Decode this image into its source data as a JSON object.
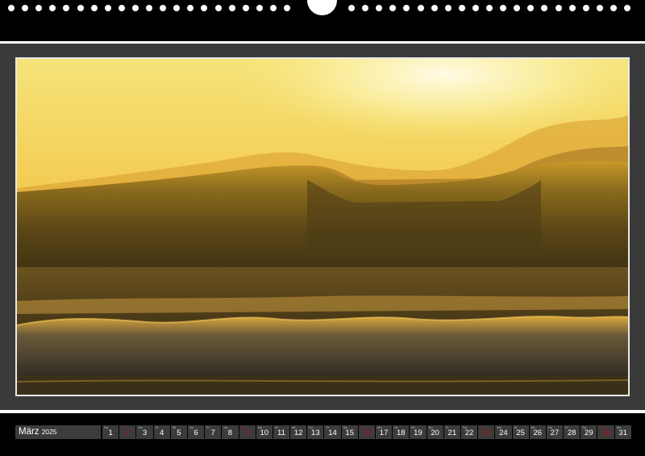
{
  "calendar": {
    "month": "März",
    "year": "2025",
    "days": [
      {
        "dow": "Sa",
        "num": "1",
        "sunday": false
      },
      {
        "dow": "So",
        "num": "2",
        "sunday": true
      },
      {
        "dow": "Mo",
        "num": "3",
        "sunday": false
      },
      {
        "dow": "Di",
        "num": "4",
        "sunday": false
      },
      {
        "dow": "Mi",
        "num": "5",
        "sunday": false
      },
      {
        "dow": "Do",
        "num": "6",
        "sunday": false
      },
      {
        "dow": "Fr",
        "num": "7",
        "sunday": false
      },
      {
        "dow": "Sa",
        "num": "8",
        "sunday": false
      },
      {
        "dow": "So",
        "num": "9",
        "sunday": true
      },
      {
        "dow": "Mo",
        "num": "10",
        "sunday": false
      },
      {
        "dow": "Di",
        "num": "11",
        "sunday": false
      },
      {
        "dow": "Mi",
        "num": "12",
        "sunday": false
      },
      {
        "dow": "Do",
        "num": "13",
        "sunday": false
      },
      {
        "dow": "Fr",
        "num": "14",
        "sunday": false
      },
      {
        "dow": "Sa",
        "num": "15",
        "sunday": false
      },
      {
        "dow": "So",
        "num": "16",
        "sunday": true
      },
      {
        "dow": "Mo",
        "num": "17",
        "sunday": false
      },
      {
        "dow": "Di",
        "num": "18",
        "sunday": false
      },
      {
        "dow": "Mi",
        "num": "19",
        "sunday": false
      },
      {
        "dow": "Do",
        "num": "20",
        "sunday": false
      },
      {
        "dow": "Fr",
        "num": "21",
        "sunday": false
      },
      {
        "dow": "Sa",
        "num": "22",
        "sunday": false
      },
      {
        "dow": "So",
        "num": "23",
        "sunday": true
      },
      {
        "dow": "Mo",
        "num": "24",
        "sunday": false
      },
      {
        "dow": "Di",
        "num": "25",
        "sunday": false
      },
      {
        "dow": "Mi",
        "num": "26",
        "sunday": false
      },
      {
        "dow": "Do",
        "num": "27",
        "sunday": false
      },
      {
        "dow": "Fr",
        "num": "28",
        "sunday": false
      },
      {
        "dow": "Sa",
        "num": "29",
        "sunday": false
      },
      {
        "dow": "So",
        "num": "30",
        "sunday": true
      },
      {
        "dow": "Mo",
        "num": "31",
        "sunday": false
      }
    ]
  },
  "colors": {
    "sunday": "#b3121b",
    "background": "#3a3a3a",
    "sky": "#f4c646",
    "sea": "#3a2e12"
  }
}
